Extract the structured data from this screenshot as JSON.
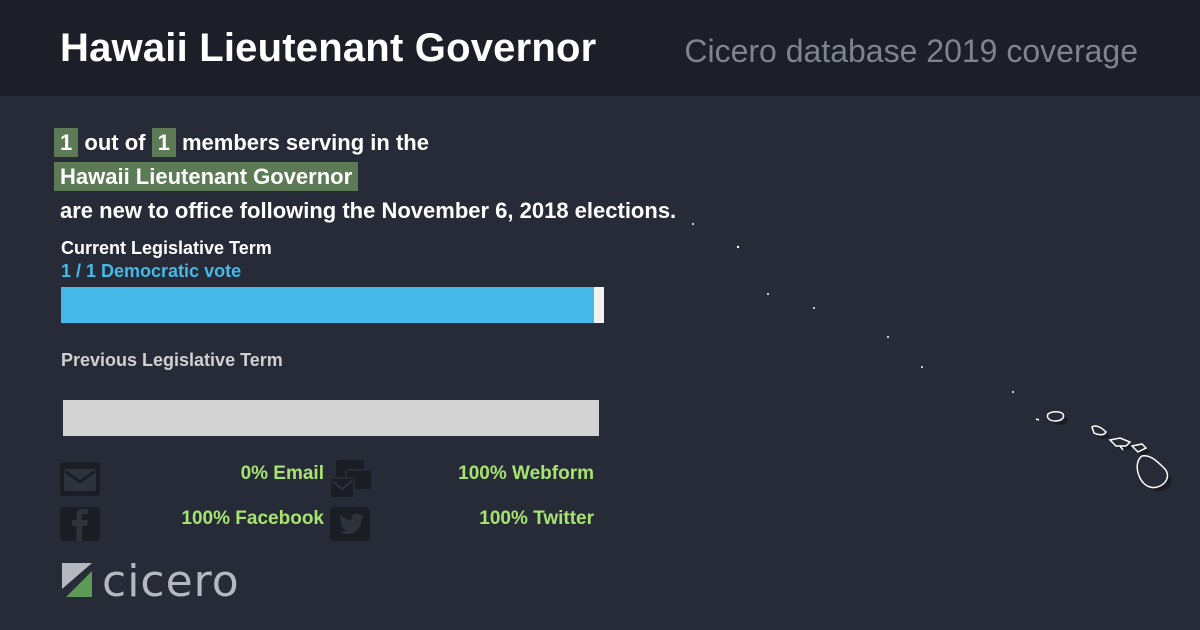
{
  "header": {
    "title": "Hawaii Lieutenant Governor",
    "subtitle": "Cicero database 2019 coverage"
  },
  "summary": {
    "new_count": "1",
    "text_out_of": "out of",
    "total_count": "1",
    "text_members": "members serving in the",
    "body_name": "Hawaii Lieutenant Governor",
    "text_following": "are new to office following the November 6, 2018 elections."
  },
  "current_term": {
    "label": "Current Legislative Term",
    "vote_label": "1 / 1 Democratic vote",
    "democratic_fraction": 0.99,
    "color": "#45b9e8"
  },
  "previous_term": {
    "label": "Previous Legislative Term",
    "color": "#d3d3d3"
  },
  "contact_stats": {
    "email": "0% Email",
    "webform": "100% Webform",
    "facebook": "100% Facebook",
    "twitter": "100% Twitter"
  },
  "brand": {
    "name": "cicero",
    "accent": "#5c7a55",
    "highlight_green": "#a6e36f"
  },
  "icons": [
    "envelope-icon",
    "webform-icon",
    "facebook-icon",
    "twitter-icon",
    "cicero-logo-icon",
    "hawaii-map-icon"
  ]
}
